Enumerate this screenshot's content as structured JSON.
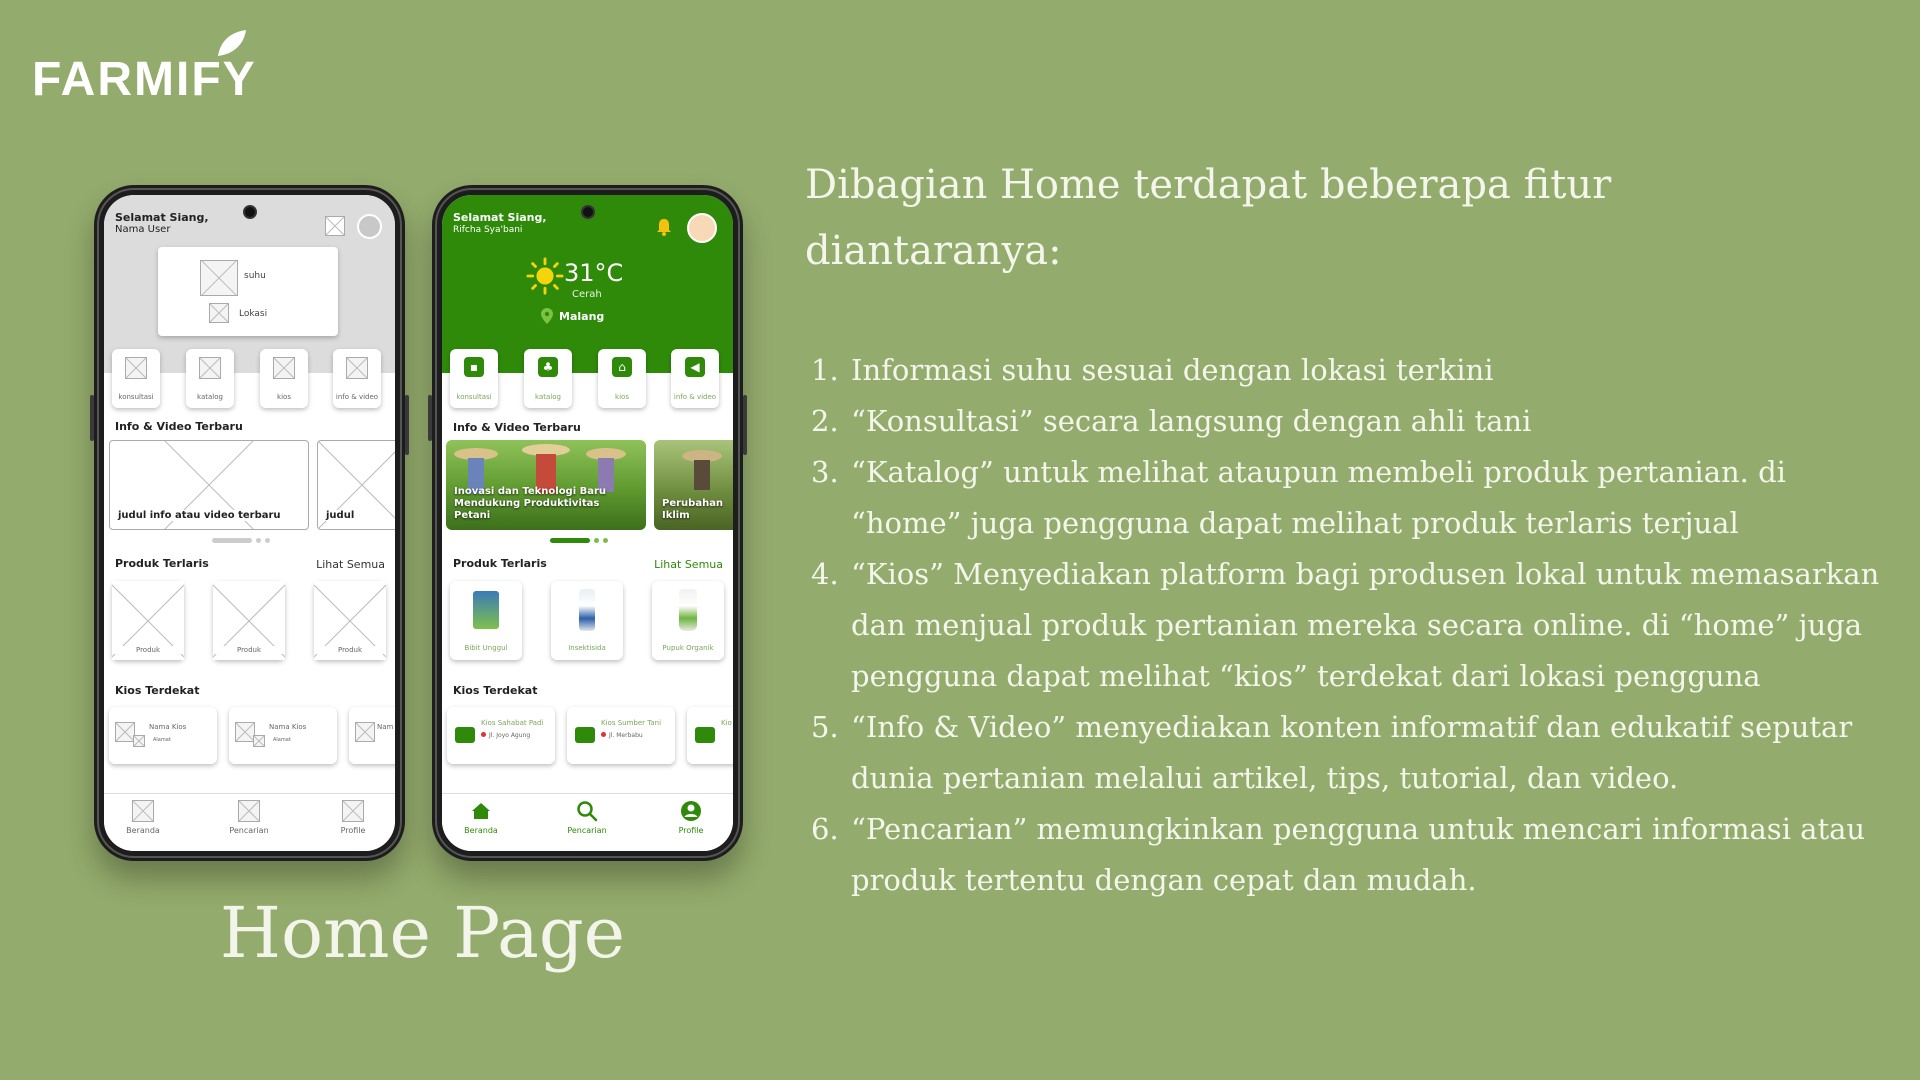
{
  "brand": {
    "name": "FARMIFY"
  },
  "caption": "Home Page",
  "intro": "Dibagian Home terdapat beberapa fitur diantaranya:",
  "features": [
    {
      "num": "1.",
      "text": "Informasi suhu sesuai dengan lokasi terkini"
    },
    {
      "num": "2.",
      "text": "“Konsultasi” secara langsung dengan ahli tani"
    },
    {
      "num": "3.",
      "text": "“Katalog” untuk melihat ataupun membeli produk pertanian. di “home” juga pengguna dapat melihat produk terlaris terjual"
    },
    {
      "num": "4.",
      "text": "“Kios” Menyediakan platform bagi produsen lokal untuk memasarkan dan menjual produk pertanian mereka secara online. di “home” juga pengguna dapat melihat “kios” terdekat dari lokasi pengguna"
    },
    {
      "num": "5.",
      "text": "“Info & Video” menyediakan konten informatif dan edukatif seputar dunia pertanian melalui artikel, tips, tutorial, dan video."
    },
    {
      "num": "6.",
      "text": "“Pencarian” memungkinkan pengguna untuk mencari informasi atau produk tertentu dengan cepat dan mudah."
    }
  ],
  "wireframe": {
    "greeting": "Selamat Siang,",
    "user": "Nama User",
    "weather_temp": "suhu",
    "weather_loc": "Lokasi",
    "categories": [
      "konsultasi",
      "katalog",
      "kios",
      "info & video"
    ],
    "info_title": "Info & Video Terbaru",
    "info_cards": [
      "judul info atau video terbaru",
      "judul"
    ],
    "products_title": "Produk Terlaris",
    "see_all": "Lihat Semua",
    "products": [
      "Produk",
      "Produk",
      "Produk"
    ],
    "kios_title": "Kios Terdekat",
    "kios": [
      {
        "name": "Nama Kios",
        "addr": "Alamat"
      },
      {
        "name": "Nama Kios",
        "addr": "Alamat"
      },
      {
        "name": "Nam",
        "addr": ""
      }
    ],
    "nav": [
      "Beranda",
      "Pencarian",
      "Profile"
    ]
  },
  "app": {
    "greeting": "Selamat Siang,",
    "user": "Rifcha Sya'bani",
    "temp": "31°C",
    "condition": "Cerah",
    "location": "Malang",
    "categories": [
      {
        "label": "konsultasi",
        "icon": "chat-icon"
      },
      {
        "label": "katalog",
        "icon": "sprout-icon"
      },
      {
        "label": "kios",
        "icon": "store-icon"
      },
      {
        "label": "info & video",
        "icon": "megaphone-icon"
      }
    ],
    "info_title": "Info & Video Terbaru",
    "info_cards": [
      "Inovasi dan Teknologi Baru Mendukung Produktivitas Petani",
      "Perubahan Iklim"
    ],
    "products_title": "Produk Terlaris",
    "see_all": "Lihat Semua",
    "products": [
      "Bibit Unggul",
      "Insektisida",
      "Pupuk Organik"
    ],
    "kios_title": "Kios Terdekat",
    "kios": [
      {
        "name": "Kios Sahabat Padi",
        "addr": "Jl. Joyo Agung"
      },
      {
        "name": "Kios Sumber Tani",
        "addr": "Jl. Merbabu"
      },
      {
        "name": "Kio",
        "addr": ""
      }
    ],
    "nav": [
      "Beranda",
      "Pencarian",
      "Profile"
    ]
  },
  "colors": {
    "background": "#93ab6c",
    "app_green": "#2f8a0a"
  }
}
